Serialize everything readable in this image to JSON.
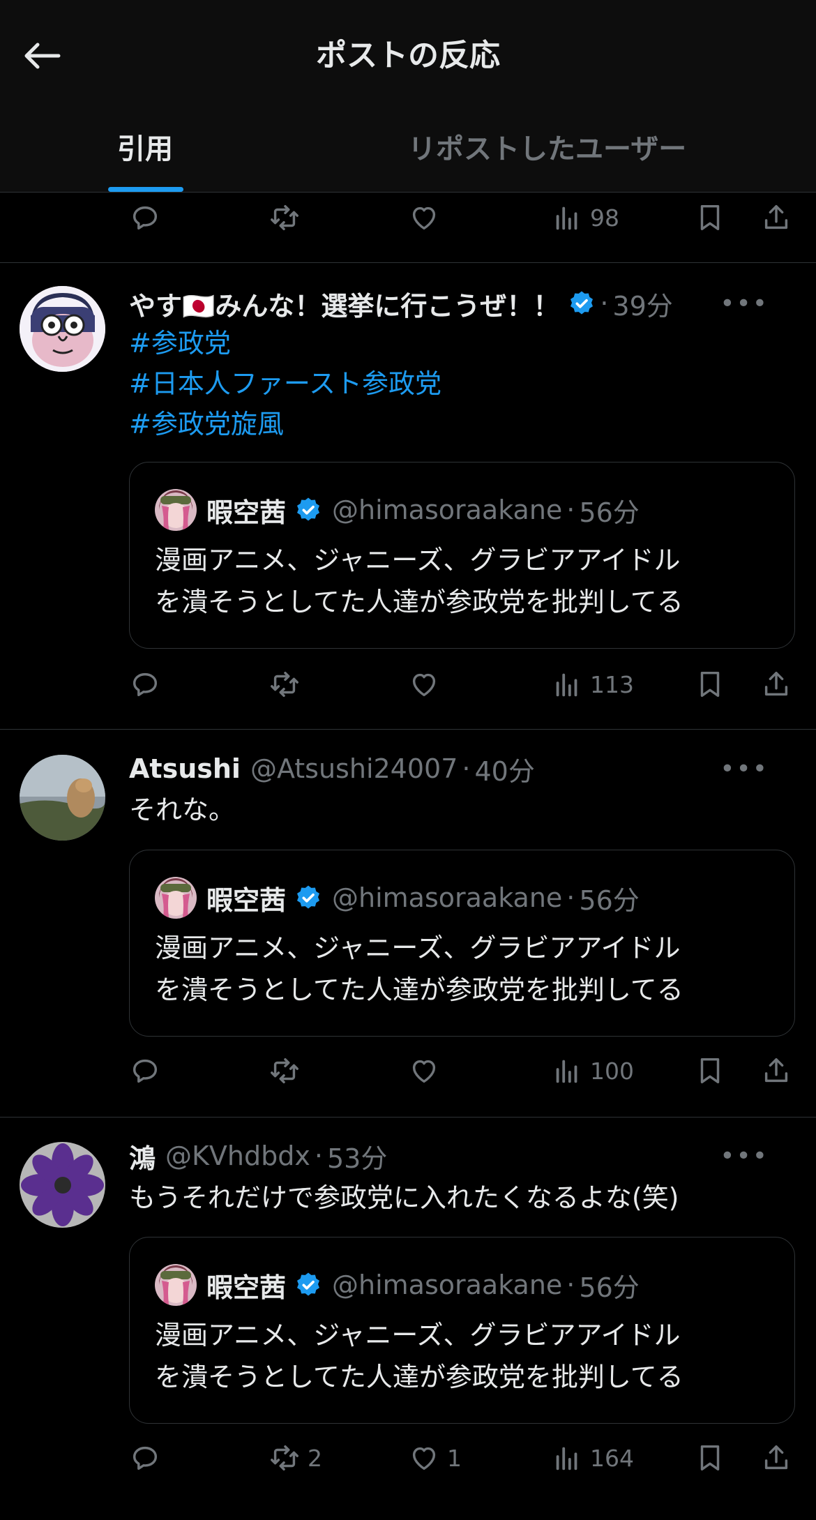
{
  "header": {
    "title": "ポストの反応",
    "back_icon": "arrow-left-icon"
  },
  "tabs": [
    {
      "label": "引用",
      "active": true
    },
    {
      "label": "リポストしたユーザー",
      "active": false
    }
  ],
  "colors": {
    "accent": "#1d9bf0",
    "muted": "#71767b",
    "background": "#000000"
  },
  "top_actions": {
    "views": "98"
  },
  "quote_original": {
    "name": "暇空茜",
    "handle": "@himasoraakane",
    "sep": "·",
    "time": "56分",
    "text_line1": "漫画アニメ、ジャニーズ、グラビアアイドル",
    "text_line2": "を潰そうとしてた人達が参政党を批判してる"
  },
  "posts": [
    {
      "name": "やす🇯🇵みんな！選挙に行こうぜ！！",
      "sep": "·",
      "time": "39分",
      "hashtags": [
        "#参政党",
        "#日本人ファースト参政党",
        "#参政党旋風"
      ],
      "views": "113"
    },
    {
      "name": "Atsushi",
      "handle": "@Atsushi24007",
      "sep": "·",
      "time": "40分",
      "text": "それな。",
      "views": "100"
    },
    {
      "name": "鴻",
      "handle": "@KVhdbdx",
      "sep": "·",
      "time": "53分",
      "text": "もうそれだけで参政党に入れたくなるよな(笑)",
      "reposts": "2",
      "likes": "1",
      "views": "164"
    }
  ],
  "more_label": "•••"
}
